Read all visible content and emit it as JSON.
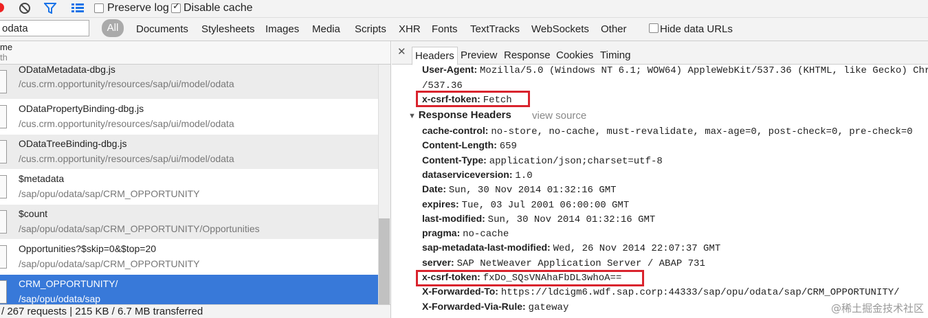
{
  "toolbar": {
    "preserve_log": "Preserve log",
    "preserve_log_checked": false,
    "disable_cache": "Disable cache",
    "disable_cache_checked": true
  },
  "filter": {
    "search_value": "odata",
    "all_label": "All",
    "types": [
      "Documents",
      "Stylesheets",
      "Images",
      "Media",
      "Scripts",
      "XHR",
      "Fonts",
      "TextTracks",
      "WebSockets",
      "Other"
    ],
    "hide_data_urls": "Hide data URLs"
  },
  "list": {
    "header_name": "me",
    "header_path": "th",
    "rows": [
      {
        "name": "ODataMetadata-dbg.js",
        "path": "/cus.crm.opportunity/resources/sap/ui/model/odata"
      },
      {
        "name": "ODataPropertyBinding-dbg.js",
        "path": "/cus.crm.opportunity/resources/sap/ui/model/odata"
      },
      {
        "name": "ODataTreeBinding-dbg.js",
        "path": "/cus.crm.opportunity/resources/sap/ui/model/odata"
      },
      {
        "name": "$metadata",
        "path": "/sap/opu/odata/sap/CRM_OPPORTUNITY"
      },
      {
        "name": "$count",
        "path": "/sap/opu/odata/sap/CRM_OPPORTUNITY/Opportunities"
      },
      {
        "name": "Opportunities?$skip=0&$top=20",
        "path": "/sap/opu/odata/sap/CRM_OPPORTUNITY"
      },
      {
        "name": "CRM_OPPORTUNITY/",
        "path": "/sap/opu/odata/sap"
      }
    ],
    "status": "/ 267 requests | 215 KB / 6.7 MB transferred"
  },
  "details": {
    "tabs": [
      "Headers",
      "Preview",
      "Response",
      "Cookies",
      "Timing"
    ],
    "request_partial": {
      "user_agent_key": "User-Agent:",
      "user_agent_val": "Mozilla/5.0 (Windows NT 6.1; WOW64) AppleWebKit/537.36 (KHTML, like Gecko) Chr",
      "user_agent_cont": "/537.36",
      "csrf_key": "x-csrf-token:",
      "csrf_val": "Fetch"
    },
    "response_title": "Response Headers",
    "view_source": "view source",
    "response_headers": [
      {
        "k": "cache-control:",
        "v": "no-store, no-cache, must-revalidate, max-age=0, post-check=0, pre-check=0"
      },
      {
        "k": "Content-Length:",
        "v": "659"
      },
      {
        "k": "Content-Type:",
        "v": "application/json;charset=utf-8"
      },
      {
        "k": "dataserviceversion:",
        "v": "1.0"
      },
      {
        "k": "Date:",
        "v": "Sun, 30 Nov 2014 01:32:16 GMT"
      },
      {
        "k": "expires:",
        "v": "Tue, 03 Jul 2001 06:00:00 GMT"
      },
      {
        "k": "last-modified:",
        "v": "Sun, 30 Nov 2014 01:32:16 GMT"
      },
      {
        "k": "pragma:",
        "v": "no-cache"
      },
      {
        "k": "sap-metadata-last-modified:",
        "v": "Wed, 26 Nov 2014 22:07:37 GMT"
      },
      {
        "k": "server:",
        "v": "SAP NetWeaver Application Server / ABAP 731"
      },
      {
        "k": "x-csrf-token:",
        "v": "fxDo_SQsVNAhaFbDL3whoA=="
      },
      {
        "k": "X-Forwarded-To:",
        "v": "https://ldcigm6.wdf.sap.corp:44333/sap/opu/odata/sap/CRM_OPPORTUNITY/"
      },
      {
        "k": "X-Forwarded-Via-Rule:",
        "v": "gateway"
      }
    ],
    "highlight_color": "#d9232d"
  },
  "watermark": "@稀土掘金技术社区"
}
